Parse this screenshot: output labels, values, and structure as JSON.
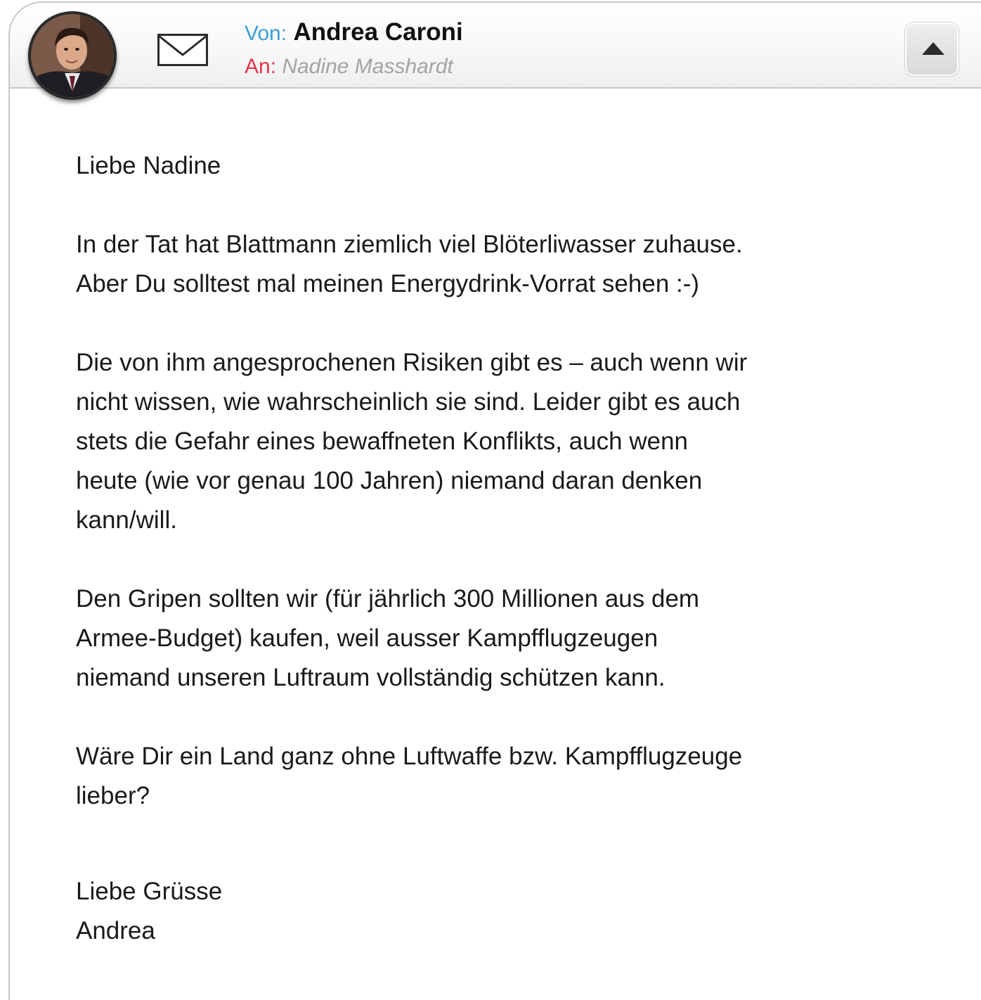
{
  "header": {
    "from_label": "Von:",
    "from_name": "Andrea Caroni",
    "to_label": "An:",
    "to_name": "Nadine Masshardt",
    "avatar_icon": "avatar-photo",
    "mail_icon": "envelope-icon",
    "collapse_icon": "triangle-up-icon"
  },
  "message": {
    "greeting": "Liebe Nadine",
    "p1_l1": "In der Tat hat Blattmann ziemlich viel Blöterliwasser zuhause.",
    "p1_l2": "Aber Du solltest mal meinen Energydrink-Vorrat sehen :-)",
    "p2_l1": "Die von ihm angesprochenen Risiken gibt es – auch wenn wir",
    "p2_l2": "nicht wissen, wie wahrscheinlich sie sind. Leider gibt es auch",
    "p2_l3": "stets die Gefahr eines bewaffneten Konflikts, auch wenn",
    "p2_l4": "heute (wie vor genau 100 Jahren) niemand daran denken",
    "p2_l5": "kann/will.",
    "p3_l1": "Den Gripen sollten wir (für jährlich 300 Millionen aus dem",
    "p3_l2": "Armee-Budget) kaufen, weil ausser Kampfflugzeugen",
    "p3_l3": "niemand unseren Luftraum vollständig schützen kann.",
    "p4_l1": "Wäre Dir ein Land ganz ohne Luftwaffe bzw. Kampfflugzeuge",
    "p4_l2": "lieber?",
    "closing": "Liebe Grüsse",
    "signature": "Andrea"
  },
  "colors": {
    "from_label": "#3a9fd6",
    "to_label": "#e8344d",
    "to_name": "#a3a3a3"
  }
}
